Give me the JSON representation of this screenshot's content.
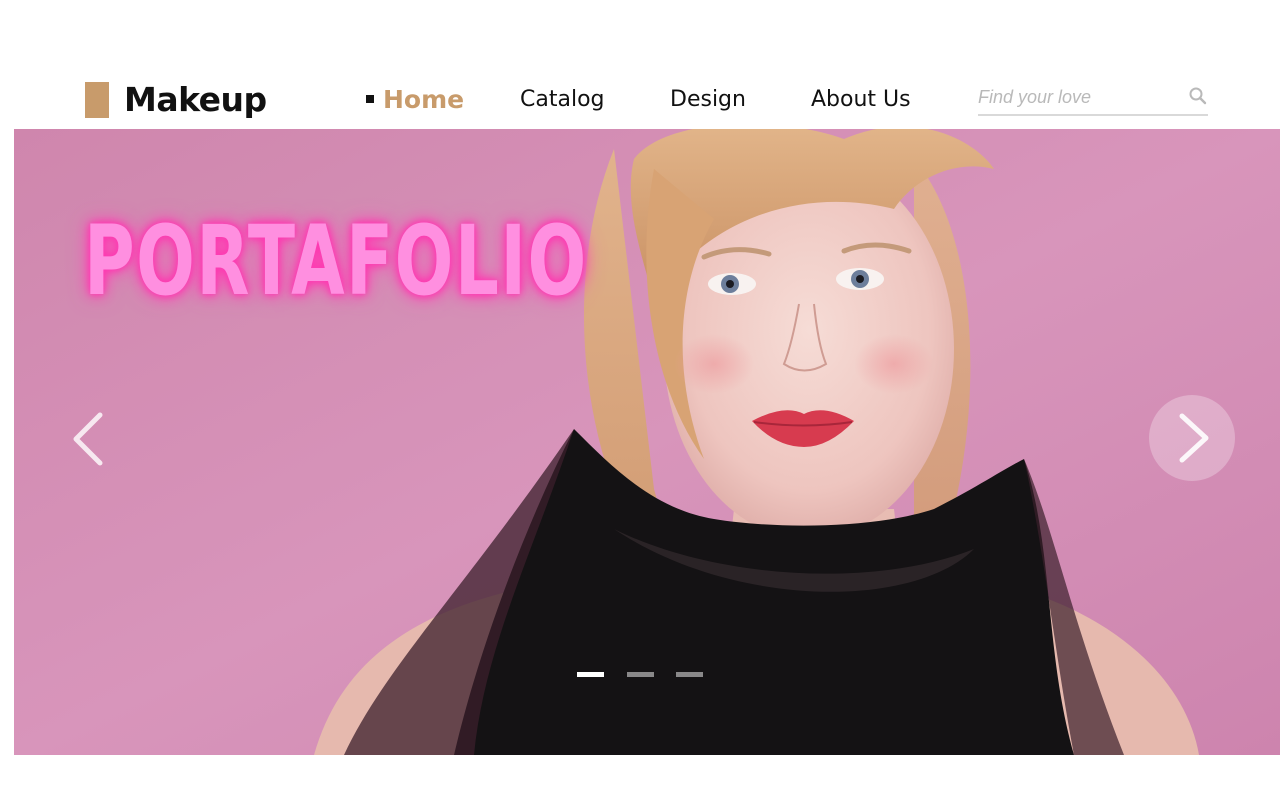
{
  "brand": {
    "name": "Makeup",
    "accent_color": "#c89b6b"
  },
  "nav": {
    "items": [
      {
        "label": "Home",
        "active": true
      },
      {
        "label": "Catalog",
        "active": false
      },
      {
        "label": "Design",
        "active": false
      },
      {
        "label": "About Us",
        "active": false
      }
    ]
  },
  "search": {
    "placeholder": "Find your love",
    "value": "",
    "icon": "search-icon"
  },
  "hero": {
    "title": "PORTAFOLIO",
    "title_color": "#ff8fe0",
    "background_color": "#d58fb6",
    "prev_icon": "chevron-left-icon",
    "next_icon": "chevron-right-icon",
    "slides": [
      {
        "active": true
      },
      {
        "active": false
      },
      {
        "active": false
      }
    ]
  }
}
